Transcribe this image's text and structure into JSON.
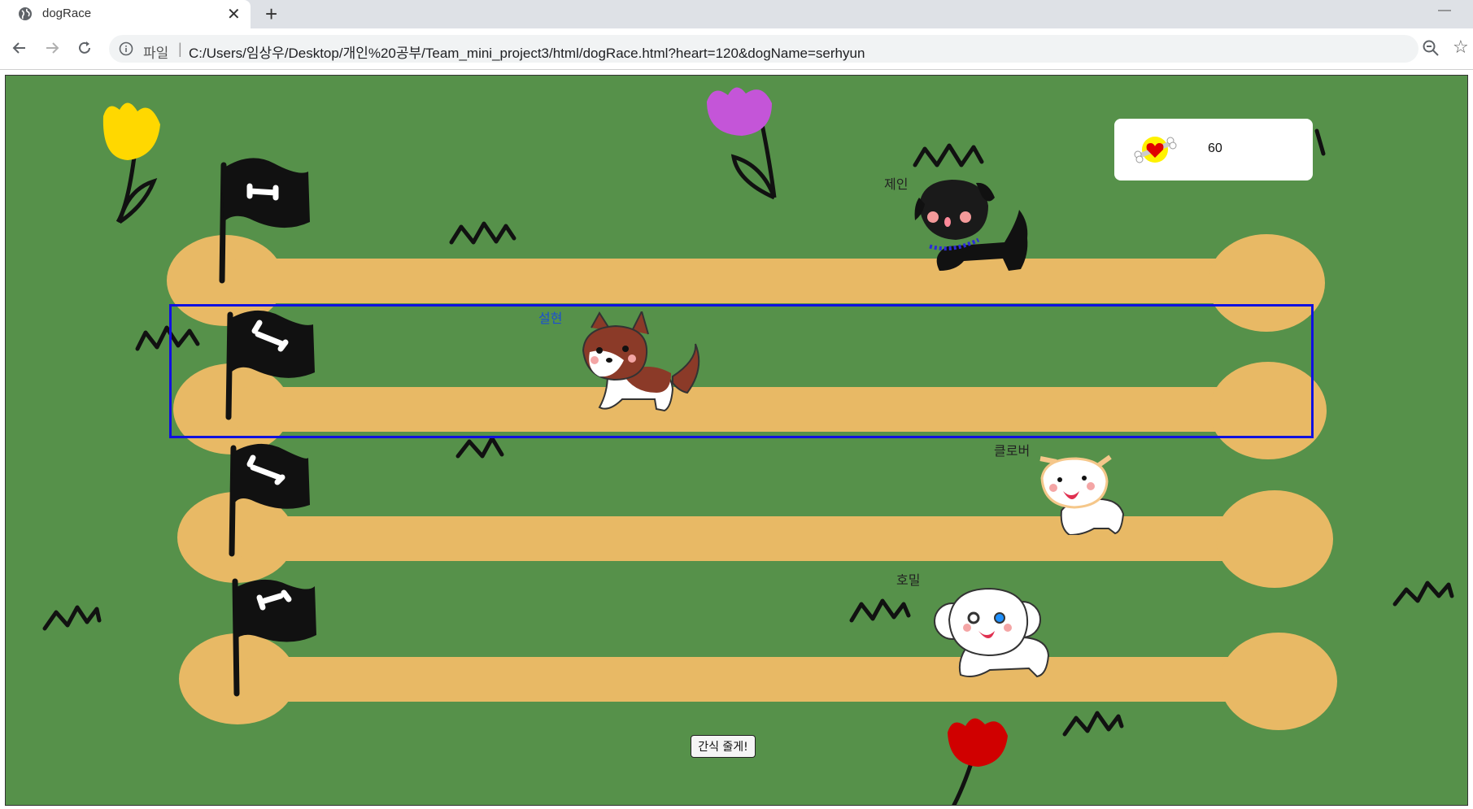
{
  "browser": {
    "tab_title": "dogRace",
    "tab_close": "✕",
    "new_tab": "+",
    "minimize": "—",
    "omnibox_scheme": "파일",
    "omnibox_sep": "|",
    "url": "C:/Users/임상우/Desktop/개인%20공부/Team_mini_project3/html/dogRace.html?heart=120&dogName=serhyun",
    "star": "☆"
  },
  "game": {
    "score": "60",
    "treat_button": "간식 줄게!",
    "dogs": [
      {
        "name": "제인",
        "color": "black",
        "selected": false
      },
      {
        "name": "설현",
        "color": "brown",
        "selected": true
      },
      {
        "name": "클로버",
        "color": "white",
        "selected": false
      },
      {
        "name": "호밀",
        "color": "white",
        "selected": false
      }
    ],
    "colors": {
      "grass": "#56914a",
      "track": "#e8b965",
      "select_border": "#1010e0"
    }
  }
}
